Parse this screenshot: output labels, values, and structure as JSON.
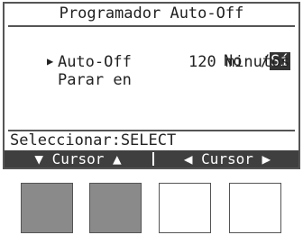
{
  "screen": {
    "title": "Programador Auto-Off",
    "rows": [
      {
        "label": "Auto-Off",
        "value_prefix": "No  /",
        "value_selected": "Sí"
      },
      {
        "label": "Parar en",
        "value": "120 minutos"
      }
    ],
    "hint": "Seleccionar:SELECT",
    "footer": {
      "left": "▼ Cursor ▲",
      "right": "◀ Cursor ▶"
    }
  },
  "hardware_buttons": [
    {
      "state": "pressed"
    },
    {
      "state": "pressed"
    },
    {
      "state": "released"
    },
    {
      "state": "released"
    }
  ],
  "colors": {
    "footer_bg": "#3f3f3f",
    "highlight": "#333333",
    "pressed_button": "#8a8a8a"
  }
}
